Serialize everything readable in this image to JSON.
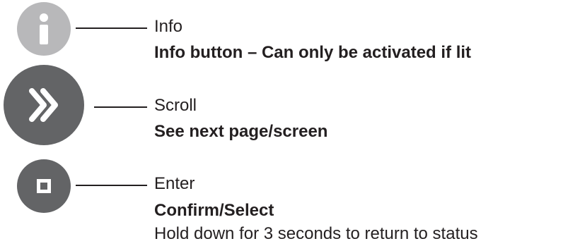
{
  "buttons": [
    {
      "name": "Info",
      "description": "Info button – Can only be activated if lit",
      "icon": "info-icon",
      "color": "#b8b8ba"
    },
    {
      "name": "Scroll",
      "description": "See next page/screen",
      "icon": "double-chevron-right-icon",
      "color": "#636466"
    },
    {
      "name": "Enter",
      "description": "Confirm/Select",
      "note": "Hold down for 3 seconds to return to status",
      "icon": "square-stop-icon",
      "color": "#636466"
    }
  ]
}
